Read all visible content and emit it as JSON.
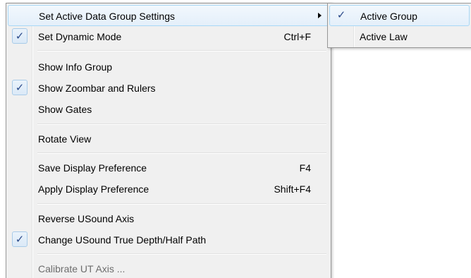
{
  "main_menu": {
    "items": [
      {
        "label": "Set Active Data Group Settings",
        "checked": false,
        "has_submenu": true,
        "highlighted": true
      },
      {
        "label": "Set Dynamic Mode",
        "shortcut": "Ctrl+F",
        "checked": true
      },
      {
        "label": "Show Info Group",
        "checked": false
      },
      {
        "label": "Show Zoombar and Rulers",
        "checked": true
      },
      {
        "label": "Show Gates",
        "checked": false
      },
      {
        "label": "Rotate View",
        "checked": false
      },
      {
        "label": "Save Display Preference",
        "shortcut": "F4",
        "checked": false
      },
      {
        "label": "Apply Display Preference",
        "shortcut": "Shift+F4",
        "checked": false
      },
      {
        "label": "Reverse USound Axis",
        "checked": false
      },
      {
        "label": "Change  USound True Depth/Half Path",
        "checked": true
      },
      {
        "label": "Calibrate UT Axis ...",
        "checked": false,
        "disabled": true
      }
    ]
  },
  "submenu": {
    "items": [
      {
        "label": "Active Group",
        "checked": true,
        "highlighted": true
      },
      {
        "label": "Active Law",
        "checked": false
      }
    ]
  },
  "check_glyph": "✓",
  "colors": {
    "menu_background": "#f0f0f0",
    "highlight_border": "#a8d8f6",
    "check_color": "#2b4a8a",
    "disabled_text": "#6d6d6d"
  }
}
